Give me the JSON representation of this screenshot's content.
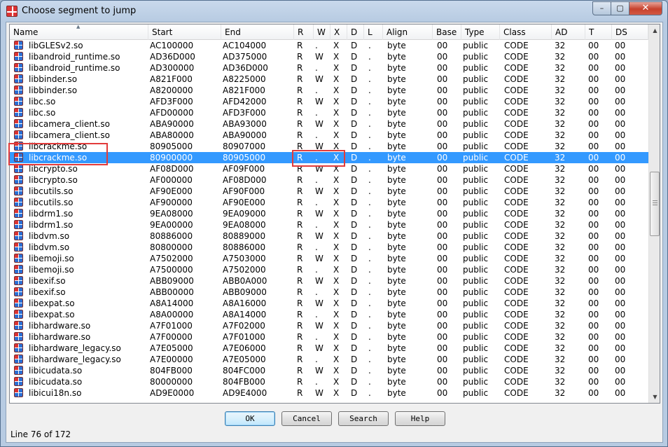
{
  "window": {
    "title": "Choose segment to jump"
  },
  "controls": {
    "minimize": "–",
    "maximize": "▢",
    "close": "✕"
  },
  "columns": [
    "Name",
    "Start",
    "End",
    "R",
    "W",
    "X",
    "D",
    "L",
    "Align",
    "Base",
    "Type",
    "Class",
    "AD",
    "T",
    "DS"
  ],
  "rows": [
    [
      "libGLESv2.so",
      "AC100000",
      "AC104000",
      "R",
      ".",
      "X",
      "D",
      ".",
      "byte",
      "00",
      "public",
      "CODE",
      "32",
      "00",
      "00"
    ],
    [
      "libandroid_runtime.so",
      "AD36D000",
      "AD375000",
      "R",
      "W",
      "X",
      "D",
      ".",
      "byte",
      "00",
      "public",
      "CODE",
      "32",
      "00",
      "00"
    ],
    [
      "libandroid_runtime.so",
      "AD300000",
      "AD36D000",
      "R",
      ".",
      "X",
      "D",
      ".",
      "byte",
      "00",
      "public",
      "CODE",
      "32",
      "00",
      "00"
    ],
    [
      "libbinder.so",
      "A821F000",
      "A8225000",
      "R",
      "W",
      "X",
      "D",
      ".",
      "byte",
      "00",
      "public",
      "CODE",
      "32",
      "00",
      "00"
    ],
    [
      "libbinder.so",
      "A8200000",
      "A821F000",
      "R",
      ".",
      "X",
      "D",
      ".",
      "byte",
      "00",
      "public",
      "CODE",
      "32",
      "00",
      "00"
    ],
    [
      "libc.so",
      "AFD3F000",
      "AFD42000",
      "R",
      "W",
      "X",
      "D",
      ".",
      "byte",
      "00",
      "public",
      "CODE",
      "32",
      "00",
      "00"
    ],
    [
      "libc.so",
      "AFD00000",
      "AFD3F000",
      "R",
      ".",
      "X",
      "D",
      ".",
      "byte",
      "00",
      "public",
      "CODE",
      "32",
      "00",
      "00"
    ],
    [
      "libcamera_client.so",
      "ABA90000",
      "ABA93000",
      "R",
      "W",
      "X",
      "D",
      ".",
      "byte",
      "00",
      "public",
      "CODE",
      "32",
      "00",
      "00"
    ],
    [
      "libcamera_client.so",
      "ABA80000",
      "ABA90000",
      "R",
      ".",
      "X",
      "D",
      ".",
      "byte",
      "00",
      "public",
      "CODE",
      "32",
      "00",
      "00"
    ],
    [
      "libcrackme.so",
      "80905000",
      "80907000",
      "R",
      "W",
      "X",
      "D",
      ".",
      "byte",
      "00",
      "public",
      "CODE",
      "32",
      "00",
      "00"
    ],
    [
      "libcrackme.so",
      "80900000",
      "80905000",
      "R",
      ".",
      "X",
      "D",
      ".",
      "byte",
      "00",
      "public",
      "CODE",
      "32",
      "00",
      "00"
    ],
    [
      "libcrypto.so",
      "AF08D000",
      "AF09F000",
      "R",
      "W",
      "X",
      "D",
      ".",
      "byte",
      "00",
      "public",
      "CODE",
      "32",
      "00",
      "00"
    ],
    [
      "libcrypto.so",
      "AF000000",
      "AF08D000",
      "R",
      ".",
      "X",
      "D",
      ".",
      "byte",
      "00",
      "public",
      "CODE",
      "32",
      "00",
      "00"
    ],
    [
      "libcutils.so",
      "AF90E000",
      "AF90F000",
      "R",
      "W",
      "X",
      "D",
      ".",
      "byte",
      "00",
      "public",
      "CODE",
      "32",
      "00",
      "00"
    ],
    [
      "libcutils.so",
      "AF900000",
      "AF90E000",
      "R",
      ".",
      "X",
      "D",
      ".",
      "byte",
      "00",
      "public",
      "CODE",
      "32",
      "00",
      "00"
    ],
    [
      "libdrm1.so",
      "9EA08000",
      "9EA09000",
      "R",
      "W",
      "X",
      "D",
      ".",
      "byte",
      "00",
      "public",
      "CODE",
      "32",
      "00",
      "00"
    ],
    [
      "libdrm1.so",
      "9EA00000",
      "9EA08000",
      "R",
      ".",
      "X",
      "D",
      ".",
      "byte",
      "00",
      "public",
      "CODE",
      "32",
      "00",
      "00"
    ],
    [
      "libdvm.so",
      "80886000",
      "80889000",
      "R",
      "W",
      "X",
      "D",
      ".",
      "byte",
      "00",
      "public",
      "CODE",
      "32",
      "00",
      "00"
    ],
    [
      "libdvm.so",
      "80800000",
      "80886000",
      "R",
      ".",
      "X",
      "D",
      ".",
      "byte",
      "00",
      "public",
      "CODE",
      "32",
      "00",
      "00"
    ],
    [
      "libemoji.so",
      "A7502000",
      "A7503000",
      "R",
      "W",
      "X",
      "D",
      ".",
      "byte",
      "00",
      "public",
      "CODE",
      "32",
      "00",
      "00"
    ],
    [
      "libemoji.so",
      "A7500000",
      "A7502000",
      "R",
      ".",
      "X",
      "D",
      ".",
      "byte",
      "00",
      "public",
      "CODE",
      "32",
      "00",
      "00"
    ],
    [
      "libexif.so",
      "ABB09000",
      "ABB0A000",
      "R",
      "W",
      "X",
      "D",
      ".",
      "byte",
      "00",
      "public",
      "CODE",
      "32",
      "00",
      "00"
    ],
    [
      "libexif.so",
      "ABB00000",
      "ABB09000",
      "R",
      ".",
      "X",
      "D",
      ".",
      "byte",
      "00",
      "public",
      "CODE",
      "32",
      "00",
      "00"
    ],
    [
      "libexpat.so",
      "A8A14000",
      "A8A16000",
      "R",
      "W",
      "X",
      "D",
      ".",
      "byte",
      "00",
      "public",
      "CODE",
      "32",
      "00",
      "00"
    ],
    [
      "libexpat.so",
      "A8A00000",
      "A8A14000",
      "R",
      ".",
      "X",
      "D",
      ".",
      "byte",
      "00",
      "public",
      "CODE",
      "32",
      "00",
      "00"
    ],
    [
      "libhardware.so",
      "A7F01000",
      "A7F02000",
      "R",
      "W",
      "X",
      "D",
      ".",
      "byte",
      "00",
      "public",
      "CODE",
      "32",
      "00",
      "00"
    ],
    [
      "libhardware.so",
      "A7F00000",
      "A7F01000",
      "R",
      ".",
      "X",
      "D",
      ".",
      "byte",
      "00",
      "public",
      "CODE",
      "32",
      "00",
      "00"
    ],
    [
      "libhardware_legacy.so",
      "A7E05000",
      "A7E06000",
      "R",
      "W",
      "X",
      "D",
      ".",
      "byte",
      "00",
      "public",
      "CODE",
      "32",
      "00",
      "00"
    ],
    [
      "libhardware_legacy.so",
      "A7E00000",
      "A7E05000",
      "R",
      ".",
      "X",
      "D",
      ".",
      "byte",
      "00",
      "public",
      "CODE",
      "32",
      "00",
      "00"
    ],
    [
      "libicudata.so",
      "804FB000",
      "804FC000",
      "R",
      "W",
      "X",
      "D",
      ".",
      "byte",
      "00",
      "public",
      "CODE",
      "32",
      "00",
      "00"
    ],
    [
      "libicudata.so",
      "80000000",
      "804FB000",
      "R",
      ".",
      "X",
      "D",
      ".",
      "byte",
      "00",
      "public",
      "CODE",
      "32",
      "00",
      "00"
    ],
    [
      "libicui18n.so",
      "AD9E0000",
      "AD9E4000",
      "R",
      "W",
      "X",
      "D",
      ".",
      "byte",
      "00",
      "public",
      "CODE",
      "32",
      "00",
      "00"
    ]
  ],
  "selected_index": 10,
  "colors": {
    "selection": "#3399ff",
    "annotation": "#e23b3b"
  },
  "buttons": {
    "ok": "OK",
    "cancel": "Cancel",
    "search": "Search",
    "help": "Help"
  },
  "status": "Line 76 of 172"
}
